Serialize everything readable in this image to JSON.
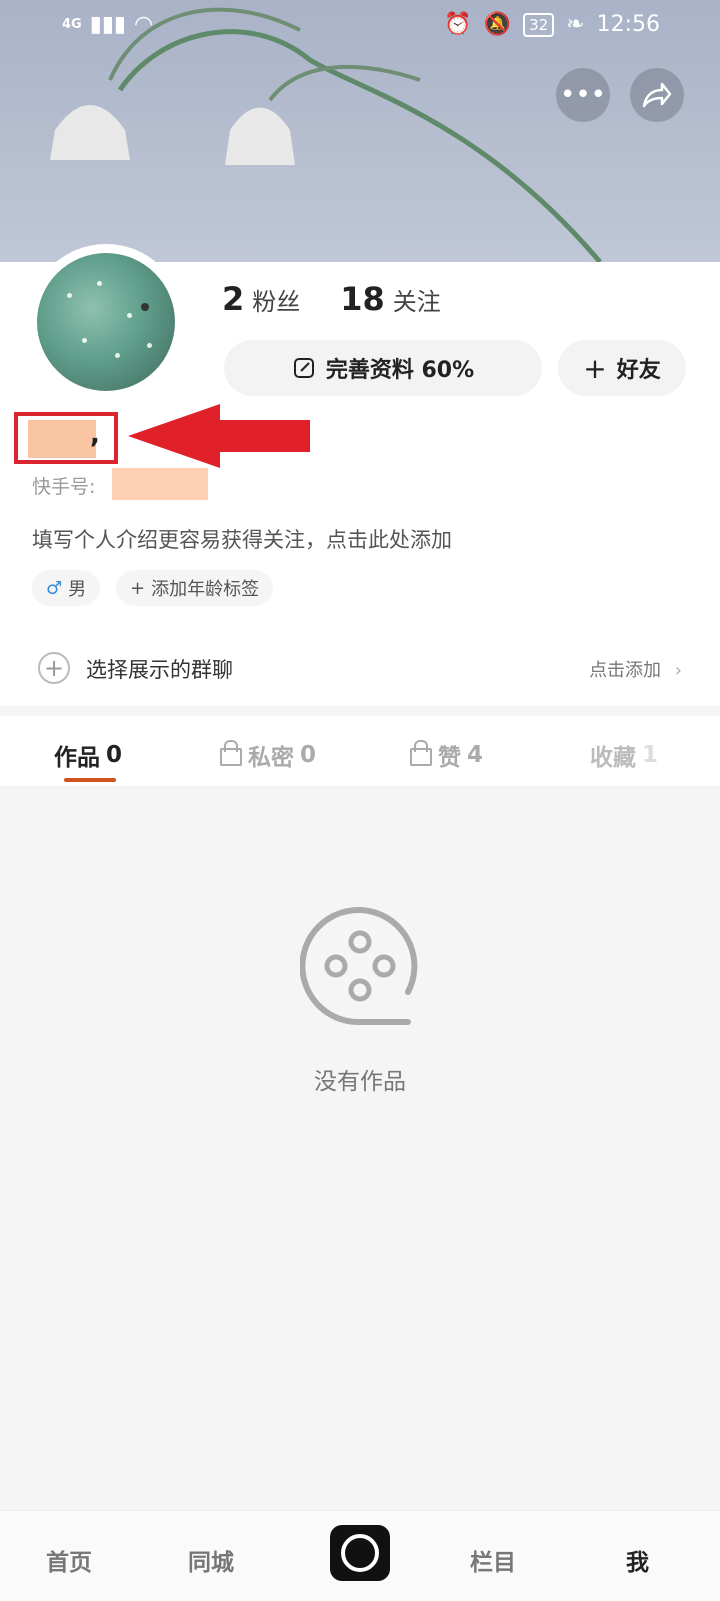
{
  "status_bar": {
    "network": "4G",
    "battery": "32",
    "time": "12:56"
  },
  "header": {
    "more_icon": "more-icon",
    "share_icon": "share-icon"
  },
  "profile": {
    "followers_count": "2",
    "followers_label": "粉丝",
    "following_count": "18",
    "following_label": "关注",
    "complete_profile_label": "完善资料 60%",
    "add_friend_label": "好友",
    "user_id_label": "快手号:",
    "bio_placeholder": "填写个人介绍更容易获得关注，点击此处添加",
    "gender_label": "男",
    "age_tag_label": "添加年龄标签"
  },
  "group_row": {
    "label": "选择展示的群聊",
    "action": "点击添加"
  },
  "tabs": [
    {
      "label": "作品",
      "count": "0"
    },
    {
      "label": "私密",
      "count": "0"
    },
    {
      "label": "赞",
      "count": "4"
    },
    {
      "label": "收藏",
      "count": "1"
    }
  ],
  "empty_state": {
    "text": "没有作品"
  },
  "bottom_nav": {
    "home": "首页",
    "nearby": "同城",
    "columns": "栏目",
    "me": "我"
  },
  "colors": {
    "accent": "#d3531f",
    "highlight_box": "#d8252f",
    "arrow": "#e02129"
  }
}
